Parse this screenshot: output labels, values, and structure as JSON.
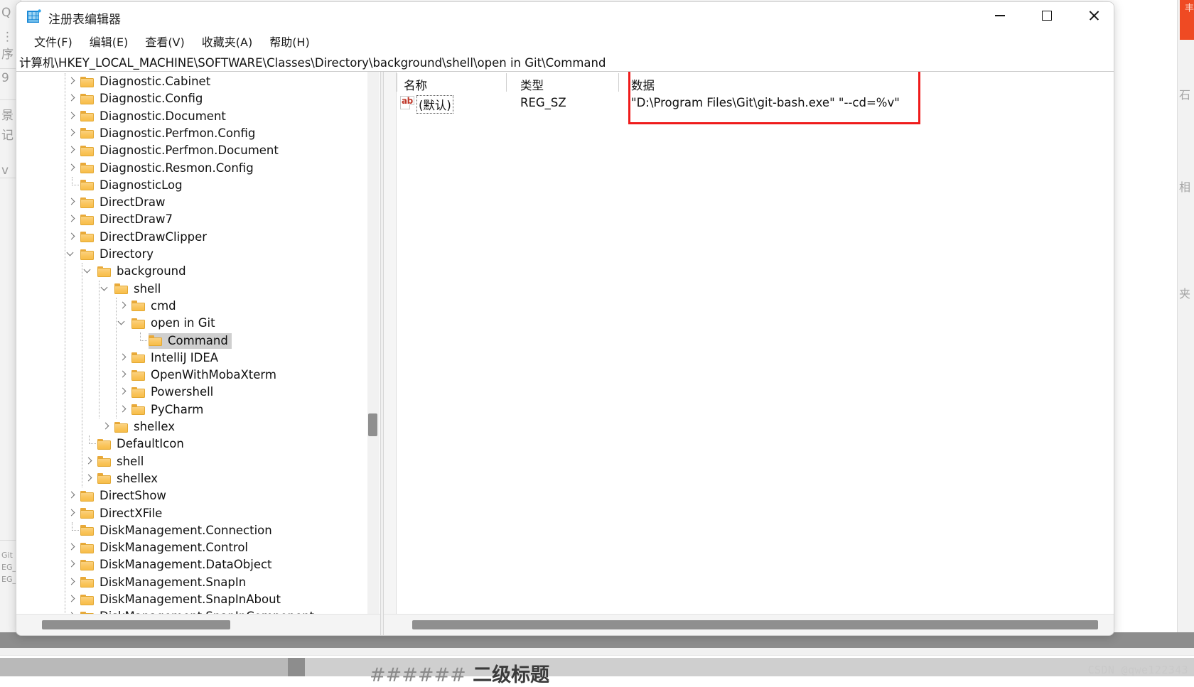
{
  "window": {
    "title": "注册表编辑器",
    "icon": "registry-editor-icon",
    "controls": {
      "minimize": "—",
      "maximize": "□",
      "close": "✕"
    }
  },
  "menubar": {
    "items": [
      {
        "label": "文件(F)"
      },
      {
        "label": "编辑(E)"
      },
      {
        "label": "查看(V)"
      },
      {
        "label": "收藏夹(A)"
      },
      {
        "label": "帮助(H)"
      }
    ]
  },
  "address_bar": {
    "path": "计算机\\HKEY_LOCAL_MACHINE\\SOFTWARE\\Classes\\Directory\\background\\shell\\open in Git\\Command"
  },
  "tree": {
    "rows": [
      {
        "label": "Diagnostic.Cabinet",
        "depth": 1,
        "state": "collapsed",
        "selected": false
      },
      {
        "label": "Diagnostic.Config",
        "depth": 1,
        "state": "collapsed",
        "selected": false
      },
      {
        "label": "Diagnostic.Document",
        "depth": 1,
        "state": "collapsed",
        "selected": false
      },
      {
        "label": "Diagnostic.Perfmon.Config",
        "depth": 1,
        "state": "collapsed",
        "selected": false
      },
      {
        "label": "Diagnostic.Perfmon.Document",
        "depth": 1,
        "state": "collapsed",
        "selected": false
      },
      {
        "label": "Diagnostic.Resmon.Config",
        "depth": 1,
        "state": "collapsed",
        "selected": false
      },
      {
        "label": "DiagnosticLog",
        "depth": 1,
        "state": "leaf",
        "selected": false
      },
      {
        "label": "DirectDraw",
        "depth": 1,
        "state": "collapsed",
        "selected": false
      },
      {
        "label": "DirectDraw7",
        "depth": 1,
        "state": "collapsed",
        "selected": false
      },
      {
        "label": "DirectDrawClipper",
        "depth": 1,
        "state": "collapsed",
        "selected": false
      },
      {
        "label": "Directory",
        "depth": 1,
        "state": "expanded",
        "selected": false
      },
      {
        "label": "background",
        "depth": 2,
        "state": "expanded",
        "selected": false
      },
      {
        "label": "shell",
        "depth": 3,
        "state": "expanded",
        "selected": false
      },
      {
        "label": "cmd",
        "depth": 4,
        "state": "collapsed",
        "selected": false
      },
      {
        "label": "open in Git",
        "depth": 4,
        "state": "expanded",
        "selected": false
      },
      {
        "label": "Command",
        "depth": 5,
        "state": "leaf",
        "selected": true
      },
      {
        "label": "IntelliJ IDEA",
        "depth": 4,
        "state": "collapsed",
        "selected": false
      },
      {
        "label": "OpenWithMobaXterm",
        "depth": 4,
        "state": "collapsed",
        "selected": false
      },
      {
        "label": "Powershell",
        "depth": 4,
        "state": "collapsed",
        "selected": false
      },
      {
        "label": "PyCharm",
        "depth": 4,
        "state": "collapsed",
        "selected": false
      },
      {
        "label": "shellex",
        "depth": 3,
        "state": "collapsed",
        "selected": false
      },
      {
        "label": "DefaultIcon",
        "depth": 2,
        "state": "leaf",
        "selected": false
      },
      {
        "label": "shell",
        "depth": 2,
        "state": "collapsed",
        "selected": false
      },
      {
        "label": "shellex",
        "depth": 2,
        "state": "collapsed",
        "selected": false
      },
      {
        "label": "DirectShow",
        "depth": 1,
        "state": "collapsed",
        "selected": false
      },
      {
        "label": "DirectXFile",
        "depth": 1,
        "state": "collapsed",
        "selected": false
      },
      {
        "label": "DiskManagement.Connection",
        "depth": 1,
        "state": "leaf",
        "selected": false
      },
      {
        "label": "DiskManagement.Control",
        "depth": 1,
        "state": "collapsed",
        "selected": false
      },
      {
        "label": "DiskManagement.DataObject",
        "depth": 1,
        "state": "collapsed",
        "selected": false
      },
      {
        "label": "DiskManagement.SnapIn",
        "depth": 1,
        "state": "collapsed",
        "selected": false
      },
      {
        "label": "DiskManagement.SnapInAbout",
        "depth": 1,
        "state": "collapsed",
        "selected": false
      },
      {
        "label": "DiskManagement.SnapInComponent",
        "depth": 1,
        "state": "collapsed",
        "selected": false
      }
    ]
  },
  "values": {
    "columns": {
      "name": "名称",
      "type": "类型",
      "data": "数据"
    },
    "rows": [
      {
        "icon": "string-value-icon",
        "name": "(默认)",
        "type": "REG_SZ",
        "data": "\"D:\\Program Files\\Git\\git-bash.exe\" \"--cd=%v\""
      }
    ],
    "highlight_color": "#ef1b1b"
  },
  "background_page": {
    "heading_hashes": "######",
    "heading_text": "二级标题"
  },
  "watermark": "CSDN @qwe122343"
}
